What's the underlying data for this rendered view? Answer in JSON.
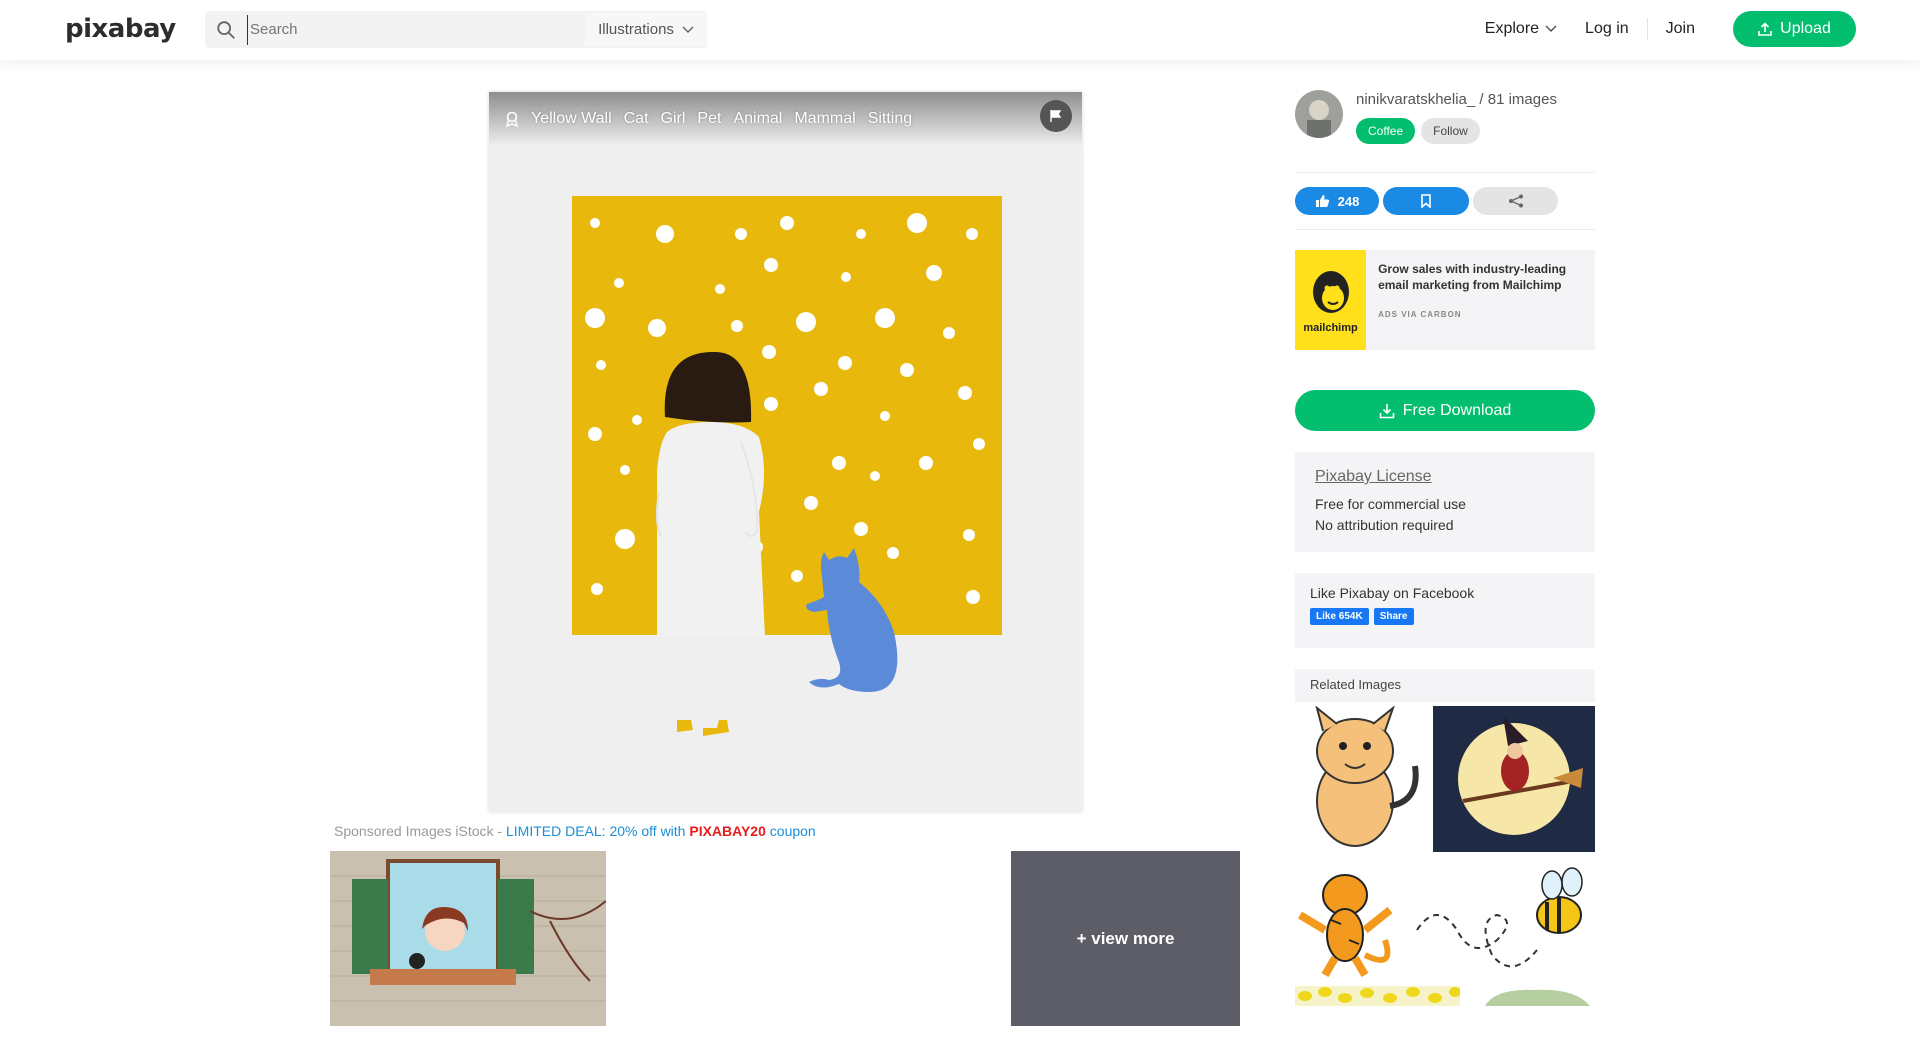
{
  "header": {
    "logo": "pixabay",
    "search_placeholder": "Search",
    "search_type": "Illustrations",
    "nav": {
      "explore": "Explore",
      "login": "Log in",
      "join": "Join",
      "upload": "Upload"
    }
  },
  "image": {
    "tags": [
      "Yellow Wall",
      "Cat",
      "Girl",
      "Pet",
      "Animal",
      "Mammal",
      "Sitting"
    ],
    "colors": {
      "wall": "#e8b90c",
      "cat": "#5b8bd8",
      "coat": "#f1f1f1",
      "hair": "#2a1b12",
      "background": "#efefef"
    }
  },
  "sponsored": {
    "prefix": "Sponsored Images iStock - ",
    "deal": "LIMITED DEAL: 20% off with ",
    "code": "PIXABAY20",
    "suffix": " coupon",
    "view_more": "+ view more"
  },
  "author": {
    "name": "ninikvaratskhelia_",
    "images": "/ 81 images",
    "coffee": "Coffee",
    "follow": "Follow"
  },
  "actions": {
    "likes": "248"
  },
  "ad": {
    "brand": "mailchimp",
    "text": "Grow sales with industry-leading email marketing from Mailchimp",
    "via": "ADS VIA CARBON"
  },
  "download": {
    "label": "Free Download"
  },
  "license": {
    "title": "Pixabay License",
    "line1": "Free for commercial use",
    "line2": "No attribution required"
  },
  "facebook": {
    "title": "Like Pixabay on Facebook",
    "like": "Like 654K",
    "share": "Share"
  },
  "related": {
    "title": "Related Images"
  },
  "brand_colors": {
    "green": "#02be6e",
    "blue": "#1a8ae5"
  }
}
